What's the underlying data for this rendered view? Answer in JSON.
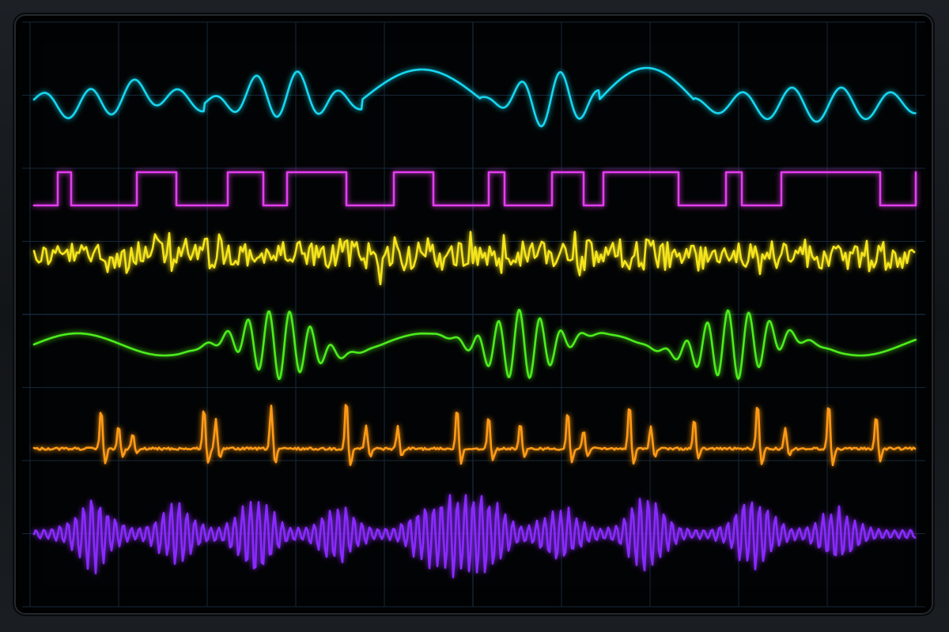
{
  "display": {
    "bezel_color": "#16191d",
    "screen_color": "#020304",
    "grid_color": "#15283a"
  },
  "traces": [
    {
      "id": "cyan-wave",
      "color": "#19d7f0",
      "kind": "mixed-sine",
      "icon": "sine-wave-icon"
    },
    {
      "id": "magenta-square",
      "color": "#e43cf0",
      "kind": "square-wave",
      "icon": "square-wave-icon"
    },
    {
      "id": "yellow-noise",
      "color": "#f4e41c",
      "kind": "noise",
      "icon": "noise-wave-icon"
    },
    {
      "id": "green-bursts",
      "color": "#4ded1a",
      "kind": "burst-wave",
      "icon": "burst-wave-icon"
    },
    {
      "id": "orange-spikes",
      "color": "#ff9a12",
      "kind": "spike-train",
      "icon": "spike-wave-icon"
    },
    {
      "id": "purple-modulated",
      "color": "#8a2bff",
      "kind": "amplitude-modulated",
      "icon": "modulated-wave-icon"
    }
  ]
}
